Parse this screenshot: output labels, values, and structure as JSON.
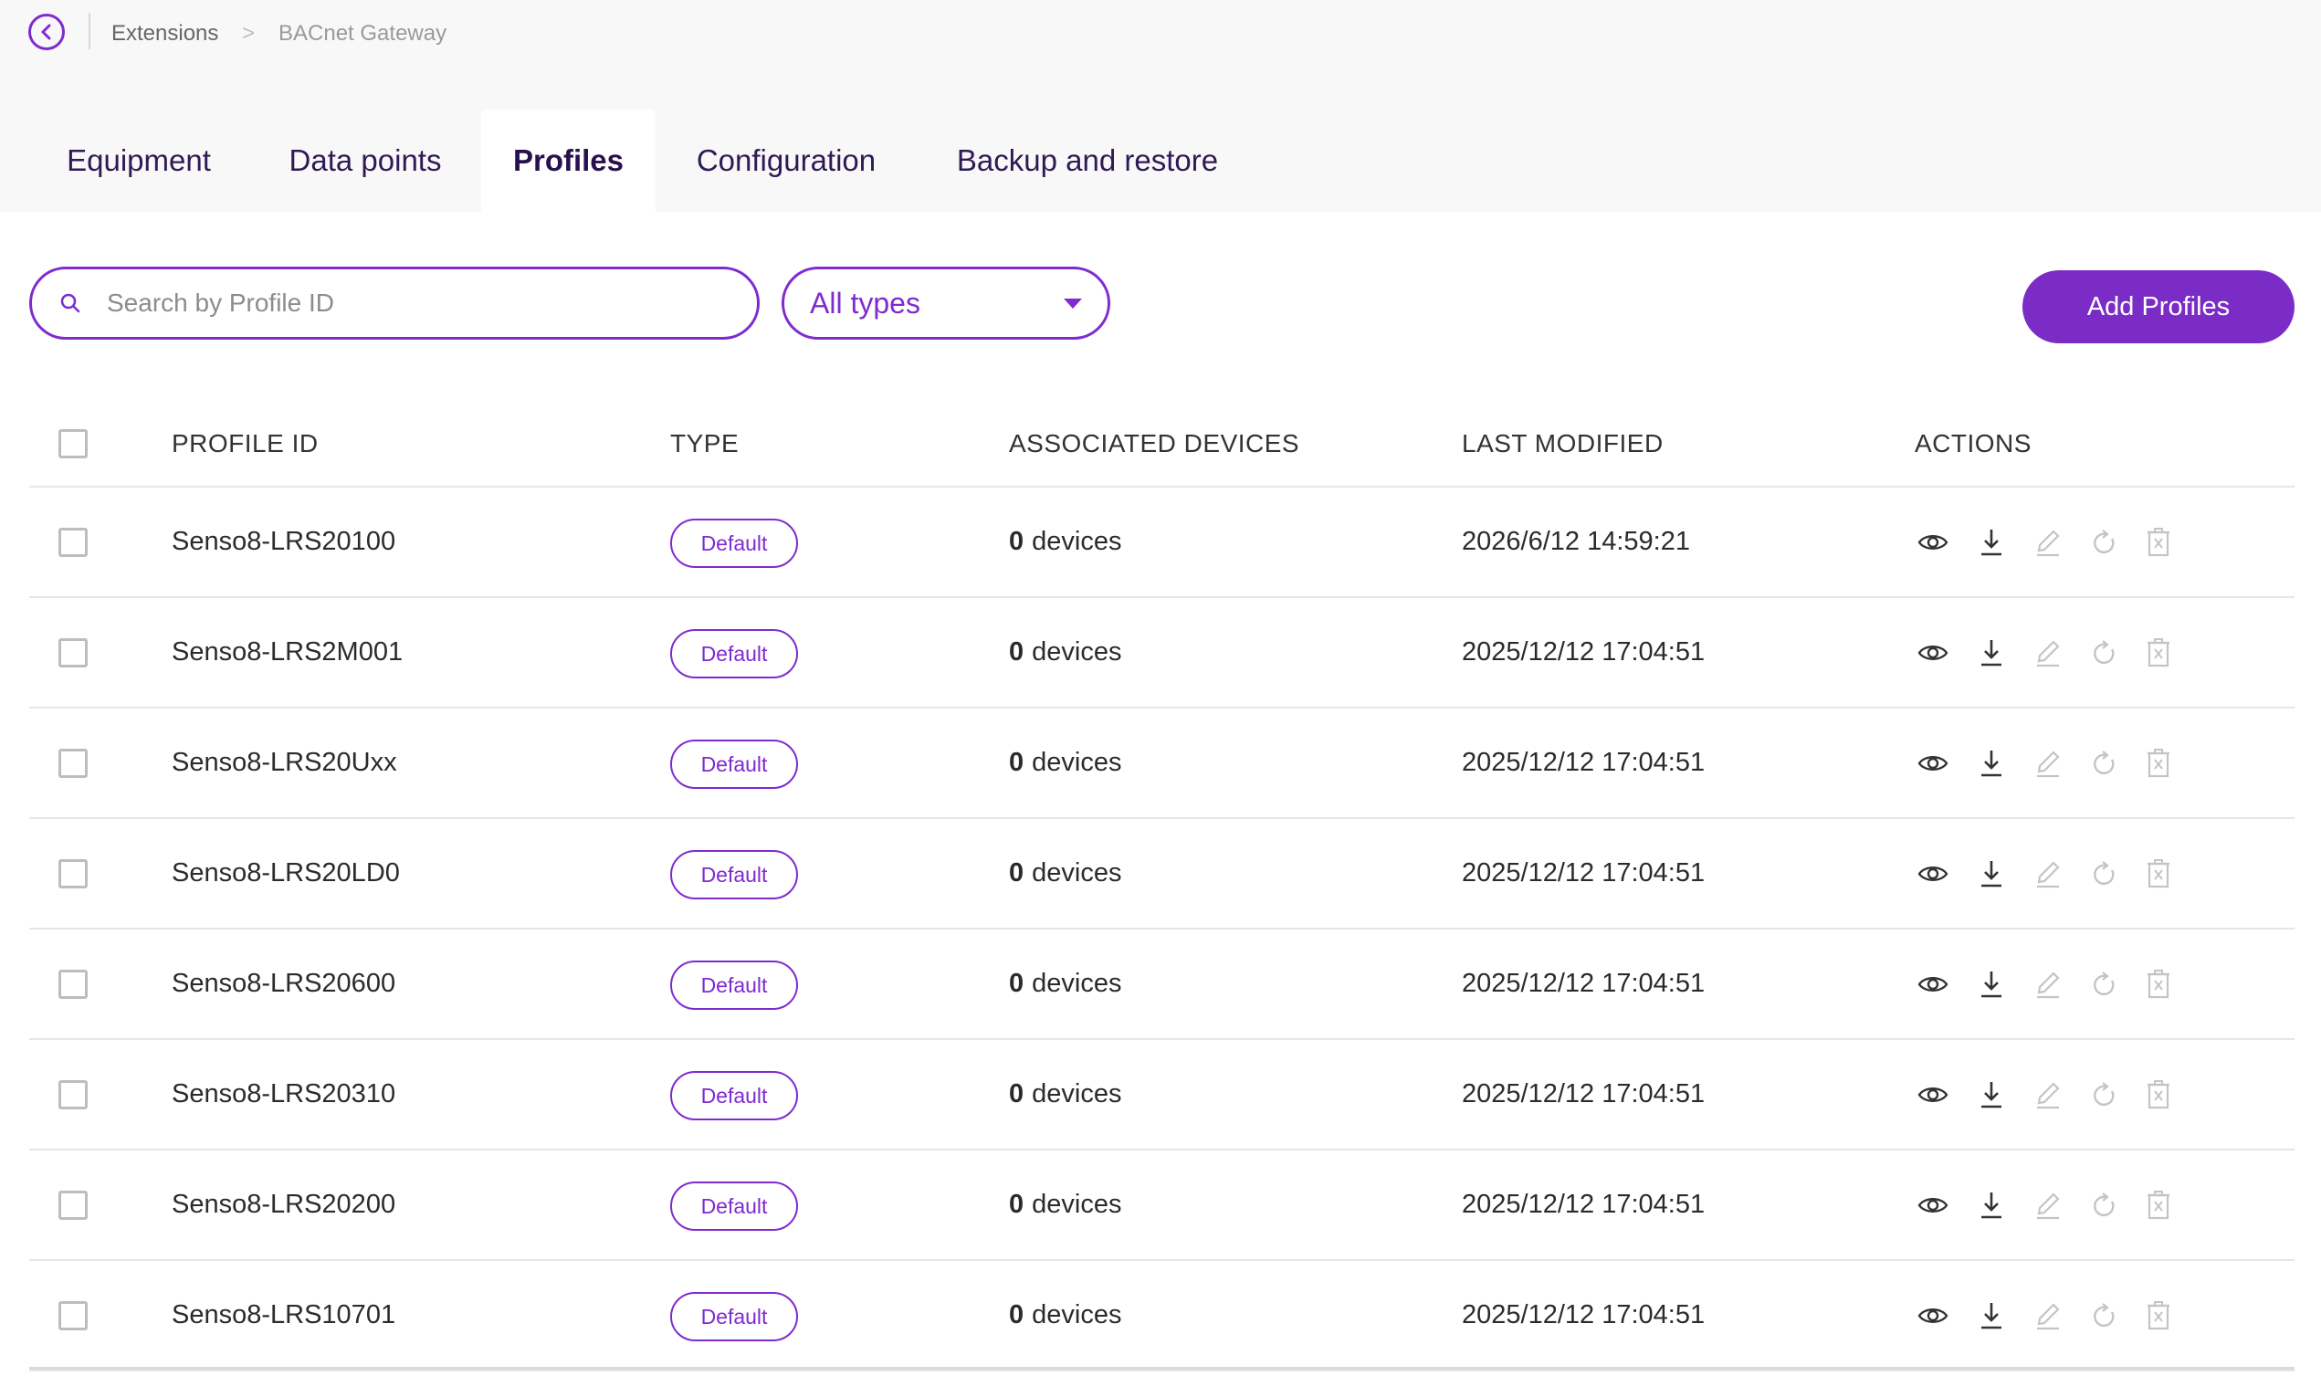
{
  "breadcrumb": {
    "parent": "Extensions",
    "separator": ">",
    "current": "BACnet Gateway"
  },
  "tabs": [
    "Equipment",
    "Data points",
    "Profiles",
    "Configuration",
    "Backup and restore"
  ],
  "active_tab": "Profiles",
  "search": {
    "placeholder": "Search by Profile ID",
    "value": ""
  },
  "type_filter": {
    "selected": "All types"
  },
  "add_button": "Add Profiles",
  "table": {
    "columns": [
      "PROFILE ID",
      "TYPE",
      "ASSOCIATED DEVICES",
      "LAST MODIFIED",
      "ACTIONS"
    ],
    "rows": [
      {
        "profile_id": "Senso8-LRS20100",
        "type": "Default",
        "count": "0",
        "unit": "devices",
        "last_modified": "2026/6/12 14:59:21"
      },
      {
        "profile_id": "Senso8-LRS2M001",
        "type": "Default",
        "count": "0",
        "unit": "devices",
        "last_modified": "2025/12/12 17:04:51"
      },
      {
        "profile_id": "Senso8-LRS20Uxx",
        "type": "Default",
        "count": "0",
        "unit": "devices",
        "last_modified": "2025/12/12 17:04:51"
      },
      {
        "profile_id": "Senso8-LRS20LD0",
        "type": "Default",
        "count": "0",
        "unit": "devices",
        "last_modified": "2025/12/12 17:04:51"
      },
      {
        "profile_id": "Senso8-LRS20600",
        "type": "Default",
        "count": "0",
        "unit": "devices",
        "last_modified": "2025/12/12 17:04:51"
      },
      {
        "profile_id": "Senso8-LRS20310",
        "type": "Default",
        "count": "0",
        "unit": "devices",
        "last_modified": "2025/12/12 17:04:51"
      },
      {
        "profile_id": "Senso8-LRS20200",
        "type": "Default",
        "count": "0",
        "unit": "devices",
        "last_modified": "2025/12/12 17:04:51"
      },
      {
        "profile_id": "Senso8-LRS10701",
        "type": "Default",
        "count": "0",
        "unit": "devices",
        "last_modified": "2025/12/12 17:04:51"
      }
    ],
    "row_actions": [
      {
        "icon": "eye-icon",
        "enabled": true
      },
      {
        "icon": "download-icon",
        "enabled": true
      },
      {
        "icon": "edit-icon",
        "enabled": false
      },
      {
        "icon": "reset-icon",
        "enabled": false
      },
      {
        "icon": "delete-icon",
        "enabled": false
      }
    ]
  },
  "colors": {
    "accent": "#7f2bd0",
    "button_bg": "#7b2cc6",
    "tab_text": "#2f1a55",
    "disabled_icon": "#c4c4c4",
    "enabled_icon": "#333333"
  }
}
